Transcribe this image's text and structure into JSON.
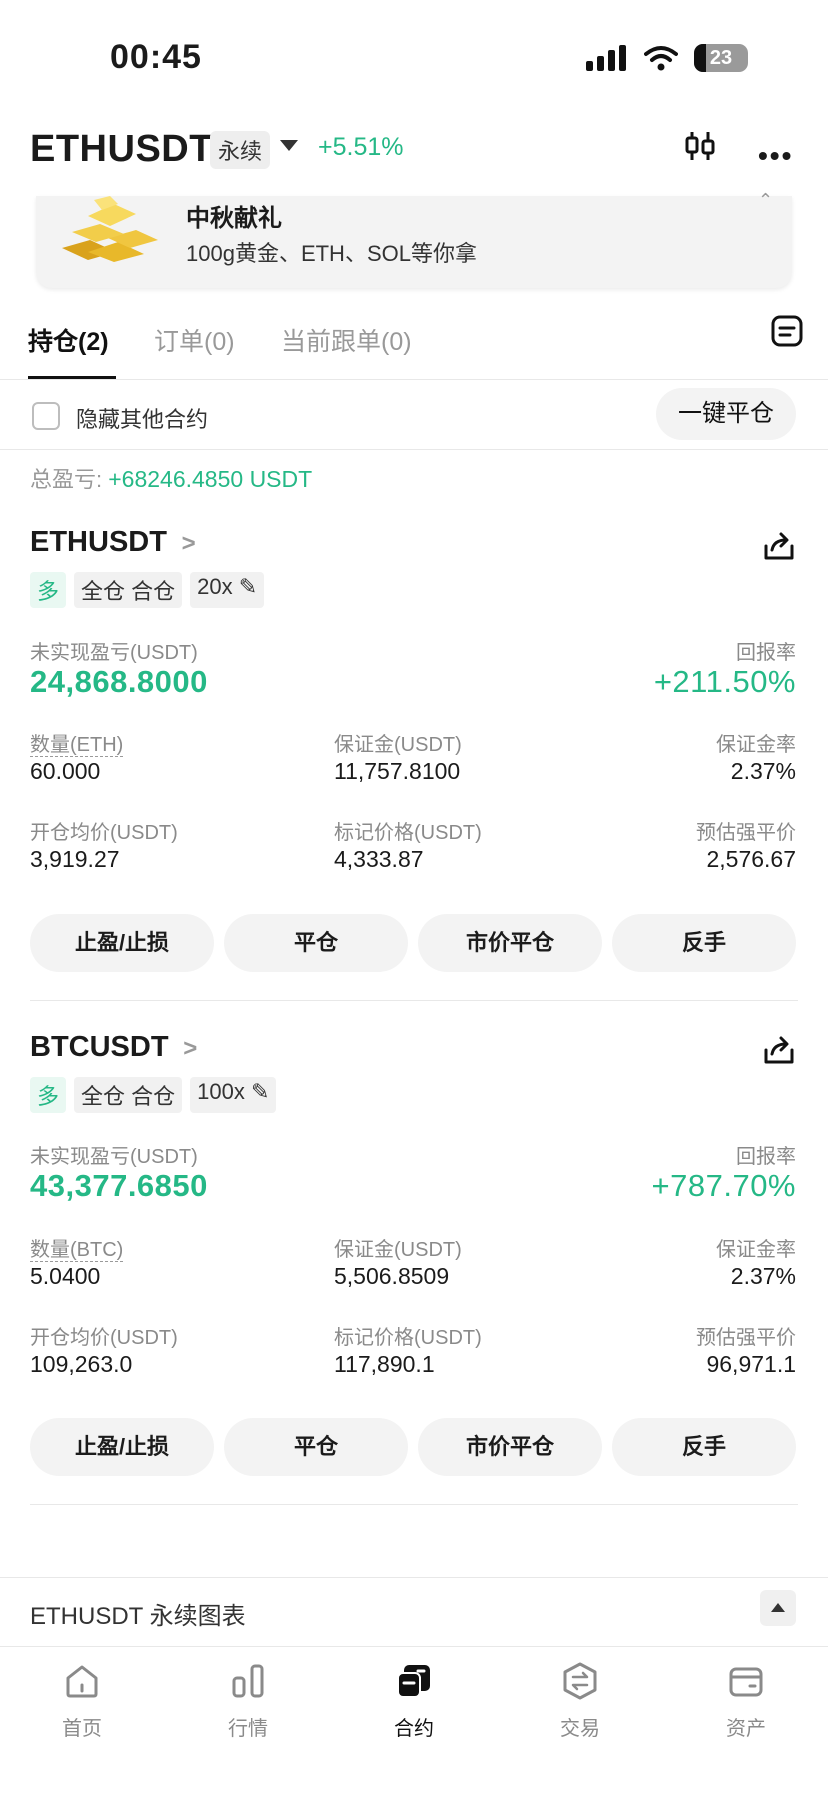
{
  "status_bar": {
    "time": "00:45",
    "battery": "23"
  },
  "header": {
    "symbol": "ETHUSDT",
    "tag": "永续",
    "change": "+5.51%"
  },
  "banner": {
    "title": "中秋献礼",
    "subtitle": "100g黄金、ETH、SOL等你拿",
    "close": "⌃"
  },
  "tabs": [
    {
      "label": "持仓(2)"
    },
    {
      "label": "订单(0)"
    },
    {
      "label": "当前跟单(0)"
    }
  ],
  "filter": {
    "hide_label": "隐藏其他合约",
    "close_all": "一键平仓"
  },
  "total": {
    "label": "总盈亏: ",
    "value": "+68246.4850 USDT"
  },
  "positions": [
    {
      "symbol": "ETHUSDT",
      "side": "多",
      "margin_mode": "全仓 合仓",
      "leverage": "20x",
      "unrealized_label": "未实现盈亏(USDT)",
      "unrealized": "24,868.8000",
      "roe_label": "回报率",
      "roe": "+211.50%",
      "qty_label": "数量(ETH)",
      "qty": "60.000",
      "margin_label": "保证金(USDT)",
      "margin": "11,757.8100",
      "margin_ratio_label": "保证金率",
      "margin_ratio": "2.37%",
      "entry_label": "开仓均价(USDT)",
      "entry": "3,919.27",
      "mark_label": "标记价格(USDT)",
      "mark": "4,333.87",
      "liq_label": "预估强平价",
      "liq": "2,576.67",
      "buttons": [
        "止盈/止损",
        "平仓",
        "市价平仓",
        "反手"
      ]
    },
    {
      "symbol": "BTCUSDT",
      "side": "多",
      "margin_mode": "全仓 合仓",
      "leverage": "100x",
      "unrealized_label": "未实现盈亏(USDT)",
      "unrealized": "43,377.6850",
      "roe_label": "回报率",
      "roe": "+787.70%",
      "qty_label": "数量(BTC)",
      "qty": "5.0400",
      "margin_label": "保证金(USDT)",
      "margin": "5,506.8509",
      "margin_ratio_label": "保证金率",
      "margin_ratio": "2.37%",
      "entry_label": "开仓均价(USDT)",
      "entry": "109,263.0",
      "mark_label": "标记价格(USDT)",
      "mark": "117,890.1",
      "liq_label": "预估强平价",
      "liq": "96,971.1",
      "buttons": [
        "止盈/止损",
        "平仓",
        "市价平仓",
        "反手"
      ]
    }
  ],
  "chart_bar": {
    "label": "ETHUSDT 永续图表"
  },
  "nav": [
    {
      "label": "首页",
      "icon": "home-icon"
    },
    {
      "label": "行情",
      "icon": "market-icon"
    },
    {
      "label": "合约",
      "icon": "futures-icon"
    },
    {
      "label": "交易",
      "icon": "trade-icon"
    },
    {
      "label": "资产",
      "icon": "wallet-icon"
    }
  ],
  "colors": {
    "accent_green": "#25b886",
    "text": "#1b1b1b",
    "muted": "#8a8a8a",
    "button_bg": "#f3f3f3"
  }
}
